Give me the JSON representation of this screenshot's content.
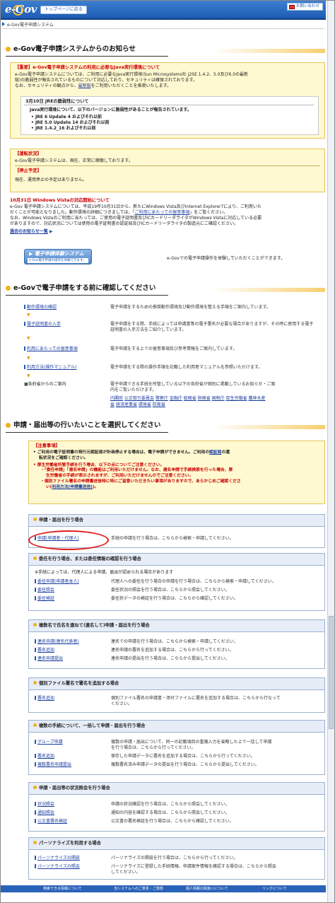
{
  "header": {
    "logo": "e-Gov",
    "top_link": "トップページに戻る",
    "inquiry": "お問い合わせ"
  },
  "breadcrumb": "e-Gov電子申請システム",
  "news": {
    "heading": "e-Gov電子申請システムからのお知らせ",
    "java": {
      "title": "【重要】e-Gov電子申請システムの利用に必要なJava実行環境について",
      "line1": "e-Gov電子申請システムについては、ご利用に必要なJava実行環境(Sun Microsystems社 J2SE 1.4.2、5.0及び6.0の最新",
      "line2": "版)の脆弱性が報告されているものについて対応しており、セキュリティは確保されております。",
      "line3a": "なお、セキュリティの観点から、",
      "line3link": "最新版",
      "line3b": "をご利用いただくことを推奨いたします。",
      "inner_title": "3月10日 JREの脆弱性について",
      "inner_line": "Java実行環境について、以下のバージョンに脆弱性があることが報告されています。",
      "versions": [
        "JRE 6 Update 4 およびそれ以前",
        "JRE 5.0 Update 14 およびそれ以前",
        "JRE 1.4.2_16 およびそれ以前"
      ]
    },
    "status": {
      "op_title": "【運転状況】",
      "op_text": "e-Gov電子申請システムは、現在、正常に稼働しております。",
      "stop_title": "【停止予定】",
      "stop_text": "現在、運用停止の予定はありません。"
    },
    "vista": {
      "title": "10月31日 Windows Vistaの対応開始について",
      "line1": "e-Gov 電子申請システムについては、平成19年10月31日から、新たにWindows Vista及びInternet Explorer7により、ご利用いた",
      "line2a": "だくことが可能となりました。動作環境の詳細につきましては、「",
      "line2link": "ご利用にあたっての留意事項",
      "line2b": "」をご覧ください。",
      "line3": "なお、Windows Vistaのご利用に当たっては、ご使用の電子証明書及びICカードリーダライタがWindows Vistaに対応している必要",
      "line4": "がありますので、対応状況については使用の電子証明書の認証局及びICカードリーダライタの製造元にご確認ください。",
      "past_link": "過去のお知らせ一覧"
    },
    "experience": {
      "button_title": "電子申請体験システム",
      "button_sub": "e-Gov電子申請の操作を体験できます。",
      "text": "e-Govでの電子申請操作を体験していただくことができます。"
    }
  },
  "check": {
    "heading": "e-Govで電子申請をする前に確認してください",
    "items": [
      {
        "label": "動作環境の確認",
        "desc1": "電子申請をするための推奨動作環境及び動作環境を整える手順をご案内しています。",
        "desc2": ""
      },
      {
        "label": "電子証明書の入手",
        "desc1": "電子申請をする際、手続によっては申請書等の電子署名が必要な場合がありますが、その時に使用する電子",
        "desc2": "証明書の入手方法をご紹介しています。"
      },
      {
        "label": "利用にあたっての留意事項",
        "desc1": "電子申請をする上での留意事項及び参考情報をご案内しています。",
        "desc2": ""
      },
      {
        "label": "利用方法(操作マニュアル)",
        "desc1": "電子申請をする際の操作手順を記載した利用者マニュアルを参照いただけます。",
        "desc2": ""
      }
    ],
    "agency_label": "各府省からのご案内",
    "agency_desc1": "電子申請できる手続を所管している以下の各府省が個別に掲載しているお知らせ・ご案",
    "agency_desc2": "内をご覧いただけます。",
    "agencies_row1": [
      "内閣府",
      "公正取引委員会",
      "警察庁",
      "金融庁",
      "総務省",
      "財務省",
      "国税庁",
      "厚生労働省",
      "農林水産"
    ],
    "agencies_row2": [
      "省",
      "経済産業省",
      "環境省",
      "防衛省"
    ]
  },
  "select": {
    "heading": "申請・届出等の行いたいことを選択してください",
    "notice": {
      "title": "【注意事項】",
      "b1a": "ご利用の電子証明書の発行元認証局が計画停止する場合は、電子申請ができません。ご利用の",
      "b1link": "認証局",
      "b1b": "の運",
      "b1c": "転状況をご確認ください。",
      "b2": "厚生労働省所管手続を行う場合、以下の点についてご注意ください。",
      "b2s1a": "「委任申請」「連名申請」の機能はご利用いただけません。なお、連名申請で手続検索を行った場合、厚",
      "b2s1b": "生労働省の手続が表示されますが、ご利用いただけませんのでご注意ください。",
      "b2s2a": "個別ファイル署名の申請書送信時に特にご留意いただきたい事項がありますので、あらかじめご確認くださ",
      "b2s2b": "い(",
      "b2s2link": "利用方法(申請書送信)",
      "b2s2c": ")。"
    },
    "groups": [
      {
        "title": "申請・届出を行う場合",
        "rows": [
          {
            "label": "申請(申請者・代理人)",
            "desc": "手続の申請を行う場合は、こちらから検索・申請してください。"
          }
        ]
      },
      {
        "title": "委任を行う場合、または委任情報の確認を行う場合",
        "note": "※手続によっては、代理人による申請、届出が認められる場合があります",
        "rows": [
          {
            "label": "委任申請(申請者本人)",
            "desc": "代理人への委任を行う場合の申請を行う場合は、こちらから検索・申請してください。"
          },
          {
            "label": "委任照会",
            "desc": "委任状況の照会を行う場合は、こちらから照会してください。"
          },
          {
            "label": "委任検証",
            "desc": "委任状データの検証を行う場合は、こちらから確認してください。"
          }
        ]
      },
      {
        "title": "複数名で氏名を連ねて(連名して)申請・届出を行う場合",
        "rows": [
          {
            "label": "連名申請(連名代表者)",
            "desc": "連名での申請を行う場合は、こちらから検索・申請してください。"
          },
          {
            "label": "署名追加",
            "desc": "連名申請の署名を追加する場合は、こちらから行ってください。"
          },
          {
            "label": "連名申請提出",
            "desc": "連名申請の提出を行う場合は、こちらから提出してください。"
          }
        ]
      },
      {
        "title": "個別ファイル署名で署名を追加する場合",
        "rows": [
          {
            "label": "署名追加",
            "desc": "個別ファイル署名の申請書・添付ファイルに署名を追加する場合は、こちらから行なって",
            "desc2": "ください。"
          }
        ]
      },
      {
        "title": "複数の手続について、一括して申請・届出を行う場合",
        "rows": [
          {
            "label": "グループ申請",
            "desc": "複数の申請・届出について、同一の記載項目の重複入力を省略した上で一括して申請",
            "desc2": "を行う場合は、こちらから行ってください。"
          },
          {
            "label": "署名追加",
            "desc": "保存した申請データに署名を追加する場合は、こちらから行ってください。"
          },
          {
            "label": "複数署名申請提出",
            "desc": "複数署名済み申請データの提出を行う場合は、こちらから提出してください。"
          }
        ]
      },
      {
        "title": "申請・届出等の状況照会を行う場合",
        "rows": [
          {
            "label": "状況照会",
            "desc": "申請の状況確認を行う場合は、こちらから照会してください。"
          },
          {
            "label": "通知照会",
            "desc": "通知の内容を確認する場合は、こちらから照会してください。"
          },
          {
            "label": "公文書署名検証",
            "desc": "公文書の署名検証を行う場合は、こちらから確認してください。"
          }
        ]
      },
      {
        "title": "パーソナライズを利用する場合",
        "rows": [
          {
            "label": "パーソナライズの関設",
            "desc": "パーソナライズの関設を行う場合は、こちらから行ってください。"
          },
          {
            "label": "パーソナライズの照会",
            "desc": "パーソナライズに登録した手続情報、申請案件情報を確認する場合は、こちらから照会",
            "desc2": "してください。"
          }
        ]
      }
    ]
  },
  "footer": [
    "検索できる情報について",
    "当システムへのご意見・ご感想",
    "個人情報の取扱いについて",
    "リンクについて"
  ],
  "colors": {
    "header": "#1e5cb3",
    "accent": "#f1b21a",
    "notice_bg": "#fff9d1",
    "red": "#c00",
    "highlight_circle": "#e21b1b"
  }
}
